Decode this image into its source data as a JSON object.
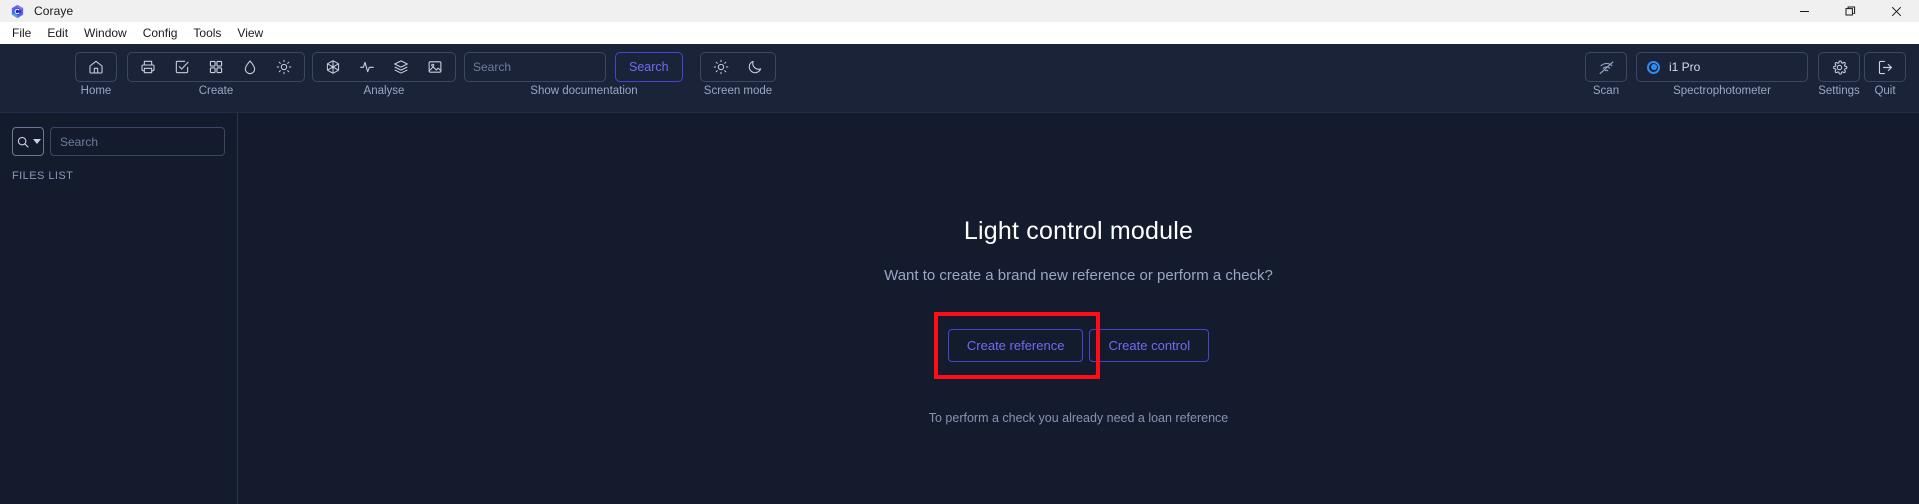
{
  "window": {
    "title": "Coraye",
    "logo_icon": "coraye-hexagon-logo",
    "controls": [
      {
        "name": "minimize",
        "icon": "minimize-icon"
      },
      {
        "name": "restore",
        "icon": "restore-icon"
      },
      {
        "name": "close",
        "icon": "close-icon"
      }
    ]
  },
  "menubar": {
    "items": [
      {
        "label": "File"
      },
      {
        "label": "Edit"
      },
      {
        "label": "Window"
      },
      {
        "label": "Config"
      },
      {
        "label": "Tools"
      },
      {
        "label": "View"
      }
    ]
  },
  "toolbar": {
    "groups": [
      {
        "label": "Home",
        "buttons": [
          {
            "name": "home-button",
            "icon": "home-icon"
          }
        ]
      },
      {
        "label": "Create",
        "buttons": [
          {
            "name": "print-button",
            "icon": "printer-icon"
          },
          {
            "name": "checklist-button",
            "icon": "check-square-icon"
          },
          {
            "name": "grid-button",
            "icon": "grid-icon"
          },
          {
            "name": "ink-button",
            "icon": "droplet-icon"
          },
          {
            "name": "light-button",
            "icon": "sun-icon"
          }
        ]
      },
      {
        "label": "Analyse",
        "buttons": [
          {
            "name": "color-space-button",
            "icon": "cube-icon"
          },
          {
            "name": "curve-button",
            "icon": "pulse-icon"
          },
          {
            "name": "layers-button",
            "icon": "layers-icon"
          },
          {
            "name": "image-button",
            "icon": "image-icon"
          }
        ]
      }
    ],
    "doc_search": {
      "placeholder": "Search",
      "value": "",
      "button_label": "Search",
      "label": "Show documentation"
    },
    "screen_mode": {
      "label": "Screen mode",
      "buttons": [
        {
          "name": "light-mode-button",
          "icon": "sun-icon"
        },
        {
          "name": "dark-mode-button",
          "icon": "moon-icon"
        }
      ]
    },
    "scan": {
      "label": "Scan",
      "icon": "scan-disabled-icon"
    },
    "spectrophotometer": {
      "label": "Spectrophotometer",
      "device": "i1 Pro",
      "selected": true,
      "accent": "#2f8cf0"
    },
    "settings": {
      "label": "Settings",
      "icon": "gear-icon"
    },
    "quit": {
      "label": "Quit",
      "icon": "exit-icon"
    }
  },
  "sidebar": {
    "search_dropdown_icon": "search-icon",
    "search_placeholder": "Search",
    "search_value": "",
    "files_list_label": "FILES LIST"
  },
  "main": {
    "title": "Light control module",
    "subtitle": "Want to create a brand new reference or perform a check?",
    "buttons": [
      {
        "name": "create-reference-button",
        "label": "Create reference",
        "highlighted": true
      },
      {
        "name": "create-control-button",
        "label": "Create control",
        "highlighted": false
      }
    ],
    "footer_note": "To perform a check you already need a loan reference"
  },
  "colors": {
    "app_background": "#141b2d",
    "toolbar_background": "#1b2339",
    "accent_blue": "#6f6bf5",
    "accent_border": "#4743d6",
    "device_accent": "#2f8cf0",
    "annotation_red": "#ff0d16",
    "muted_text": "#9aa6c4"
  }
}
